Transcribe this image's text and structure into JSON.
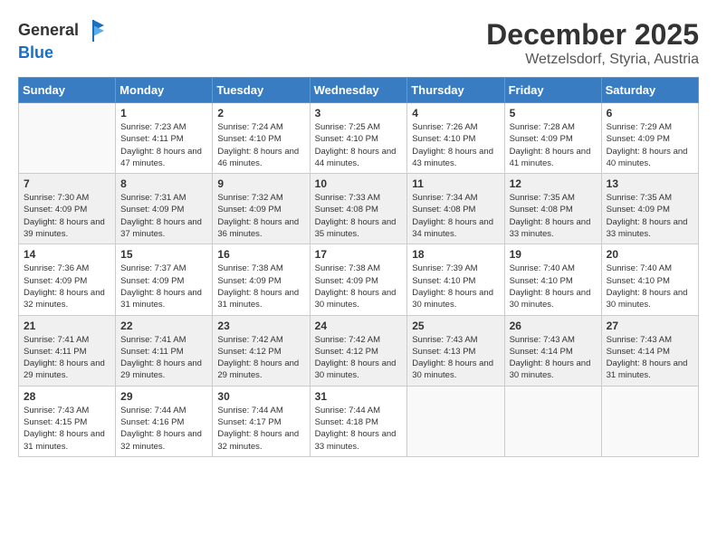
{
  "header": {
    "logo_line1": "General",
    "logo_line2": "Blue",
    "month": "December 2025",
    "location": "Wetzelsdorf, Styria, Austria"
  },
  "days_of_week": [
    "Sunday",
    "Monday",
    "Tuesday",
    "Wednesday",
    "Thursday",
    "Friday",
    "Saturday"
  ],
  "weeks": [
    [
      {
        "day": "",
        "empty": true
      },
      {
        "day": "1",
        "sunrise": "7:23 AM",
        "sunset": "4:11 PM",
        "daylight": "8 hours and 47 minutes."
      },
      {
        "day": "2",
        "sunrise": "7:24 AM",
        "sunset": "4:10 PM",
        "daylight": "8 hours and 46 minutes."
      },
      {
        "day": "3",
        "sunrise": "7:25 AM",
        "sunset": "4:10 PM",
        "daylight": "8 hours and 44 minutes."
      },
      {
        "day": "4",
        "sunrise": "7:26 AM",
        "sunset": "4:10 PM",
        "daylight": "8 hours and 43 minutes."
      },
      {
        "day": "5",
        "sunrise": "7:28 AM",
        "sunset": "4:09 PM",
        "daylight": "8 hours and 41 minutes."
      },
      {
        "day": "6",
        "sunrise": "7:29 AM",
        "sunset": "4:09 PM",
        "daylight": "8 hours and 40 minutes."
      }
    ],
    [
      {
        "day": "7",
        "sunrise": "7:30 AM",
        "sunset": "4:09 PM",
        "daylight": "8 hours and 39 minutes."
      },
      {
        "day": "8",
        "sunrise": "7:31 AM",
        "sunset": "4:09 PM",
        "daylight": "8 hours and 37 minutes."
      },
      {
        "day": "9",
        "sunrise": "7:32 AM",
        "sunset": "4:09 PM",
        "daylight": "8 hours and 36 minutes."
      },
      {
        "day": "10",
        "sunrise": "7:33 AM",
        "sunset": "4:08 PM",
        "daylight": "8 hours and 35 minutes."
      },
      {
        "day": "11",
        "sunrise": "7:34 AM",
        "sunset": "4:08 PM",
        "daylight": "8 hours and 34 minutes."
      },
      {
        "day": "12",
        "sunrise": "7:35 AM",
        "sunset": "4:08 PM",
        "daylight": "8 hours and 33 minutes."
      },
      {
        "day": "13",
        "sunrise": "7:35 AM",
        "sunset": "4:09 PM",
        "daylight": "8 hours and 33 minutes."
      }
    ],
    [
      {
        "day": "14",
        "sunrise": "7:36 AM",
        "sunset": "4:09 PM",
        "daylight": "8 hours and 32 minutes."
      },
      {
        "day": "15",
        "sunrise": "7:37 AM",
        "sunset": "4:09 PM",
        "daylight": "8 hours and 31 minutes."
      },
      {
        "day": "16",
        "sunrise": "7:38 AM",
        "sunset": "4:09 PM",
        "daylight": "8 hours and 31 minutes."
      },
      {
        "day": "17",
        "sunrise": "7:38 AM",
        "sunset": "4:09 PM",
        "daylight": "8 hours and 30 minutes."
      },
      {
        "day": "18",
        "sunrise": "7:39 AM",
        "sunset": "4:10 PM",
        "daylight": "8 hours and 30 minutes."
      },
      {
        "day": "19",
        "sunrise": "7:40 AM",
        "sunset": "4:10 PM",
        "daylight": "8 hours and 30 minutes."
      },
      {
        "day": "20",
        "sunrise": "7:40 AM",
        "sunset": "4:10 PM",
        "daylight": "8 hours and 30 minutes."
      }
    ],
    [
      {
        "day": "21",
        "sunrise": "7:41 AM",
        "sunset": "4:11 PM",
        "daylight": "8 hours and 29 minutes."
      },
      {
        "day": "22",
        "sunrise": "7:41 AM",
        "sunset": "4:11 PM",
        "daylight": "8 hours and 29 minutes."
      },
      {
        "day": "23",
        "sunrise": "7:42 AM",
        "sunset": "4:12 PM",
        "daylight": "8 hours and 29 minutes."
      },
      {
        "day": "24",
        "sunrise": "7:42 AM",
        "sunset": "4:12 PM",
        "daylight": "8 hours and 30 minutes."
      },
      {
        "day": "25",
        "sunrise": "7:43 AM",
        "sunset": "4:13 PM",
        "daylight": "8 hours and 30 minutes."
      },
      {
        "day": "26",
        "sunrise": "7:43 AM",
        "sunset": "4:14 PM",
        "daylight": "8 hours and 30 minutes."
      },
      {
        "day": "27",
        "sunrise": "7:43 AM",
        "sunset": "4:14 PM",
        "daylight": "8 hours and 31 minutes."
      }
    ],
    [
      {
        "day": "28",
        "sunrise": "7:43 AM",
        "sunset": "4:15 PM",
        "daylight": "8 hours and 31 minutes."
      },
      {
        "day": "29",
        "sunrise": "7:44 AM",
        "sunset": "4:16 PM",
        "daylight": "8 hours and 32 minutes."
      },
      {
        "day": "30",
        "sunrise": "7:44 AM",
        "sunset": "4:17 PM",
        "daylight": "8 hours and 32 minutes."
      },
      {
        "day": "31",
        "sunrise": "7:44 AM",
        "sunset": "4:18 PM",
        "daylight": "8 hours and 33 minutes."
      },
      {
        "day": "",
        "empty": true
      },
      {
        "day": "",
        "empty": true
      },
      {
        "day": "",
        "empty": true
      }
    ]
  ]
}
